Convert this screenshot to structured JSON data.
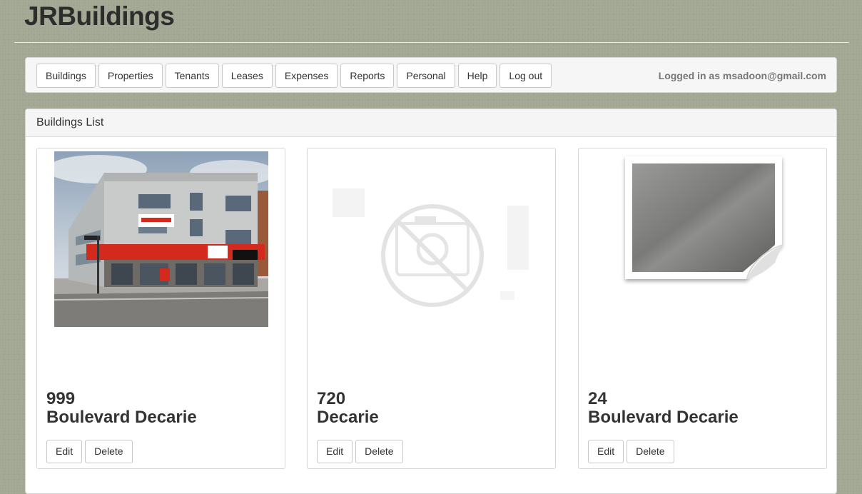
{
  "app": {
    "title": "JRBuildings"
  },
  "nav": {
    "items": [
      {
        "label": "Buildings"
      },
      {
        "label": "Properties"
      },
      {
        "label": "Tenants"
      },
      {
        "label": "Leases"
      },
      {
        "label": "Expenses"
      },
      {
        "label": "Reports"
      },
      {
        "label": "Personal"
      },
      {
        "label": "Help"
      },
      {
        "label": "Log out"
      }
    ],
    "logged_in": "Logged in as msadoon@gmail.com"
  },
  "panel": {
    "title": "Buildings List"
  },
  "buildings": [
    {
      "number": "999",
      "street": "Boulevard Decarie",
      "image": "building-photo",
      "edit_label": "Edit",
      "delete_label": "Delete"
    },
    {
      "number": "720",
      "street": "Decarie",
      "image": "no-photo-icon",
      "edit_label": "Edit",
      "delete_label": "Delete"
    },
    {
      "number": "24",
      "street": "Boulevard Decarie",
      "image": "image-placeholder-icon",
      "edit_label": "Edit",
      "delete_label": "Delete"
    }
  ],
  "colors": {
    "background": "#a3a894",
    "title": "#2d2d2d",
    "shop_sign_red": "#d42a1e"
  }
}
